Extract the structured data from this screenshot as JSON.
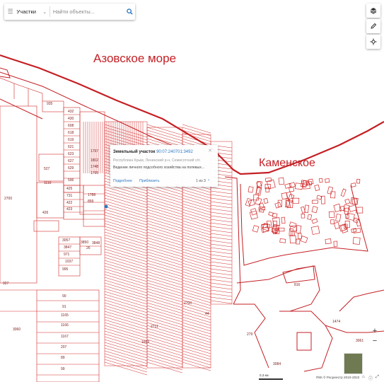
{
  "search": {
    "layer": "Участки",
    "placeholder": "Найти объекты..."
  },
  "map_labels": {
    "sea": "Азовское море",
    "village": "Каменское"
  },
  "plot_numbers": [
    "935",
    "432",
    "430",
    "608",
    "618",
    "619",
    "621",
    "623",
    "627",
    "629",
    "596",
    "1110",
    "425",
    "731",
    "422",
    "423",
    "426",
    "527",
    "1797",
    "1802",
    "1748",
    "1795",
    "1788",
    "859",
    "2700",
    "3057",
    "3850",
    "3848",
    "3847",
    "971",
    "1037",
    "26",
    "995",
    "927",
    "90",
    "91",
    "1165",
    "1166",
    "1167",
    "207",
    "89",
    "99",
    "3060",
    "3084",
    "279",
    "1474",
    "3061",
    "2711",
    "2700",
    "44",
    "816",
    "1663"
  ],
  "popup": {
    "title": "Земельный участок",
    "cadastral_number": "90:07:240701:3492",
    "address": "Республика Крым, Ленинский р-н, Семисотский с/п",
    "land_use": "Ведение личного подсобного хозяйства на полевых...",
    "details_link": "Подробнее",
    "zoom_link": "Приблизить",
    "pager": "1 из 3"
  },
  "scale_label": "0,3 км",
  "copyright": "ПКК © Росреестр 2010-2022",
  "colors": {
    "boundary": "#c41f24",
    "plot_line": "#d12a2a",
    "link": "#2a78c2"
  }
}
